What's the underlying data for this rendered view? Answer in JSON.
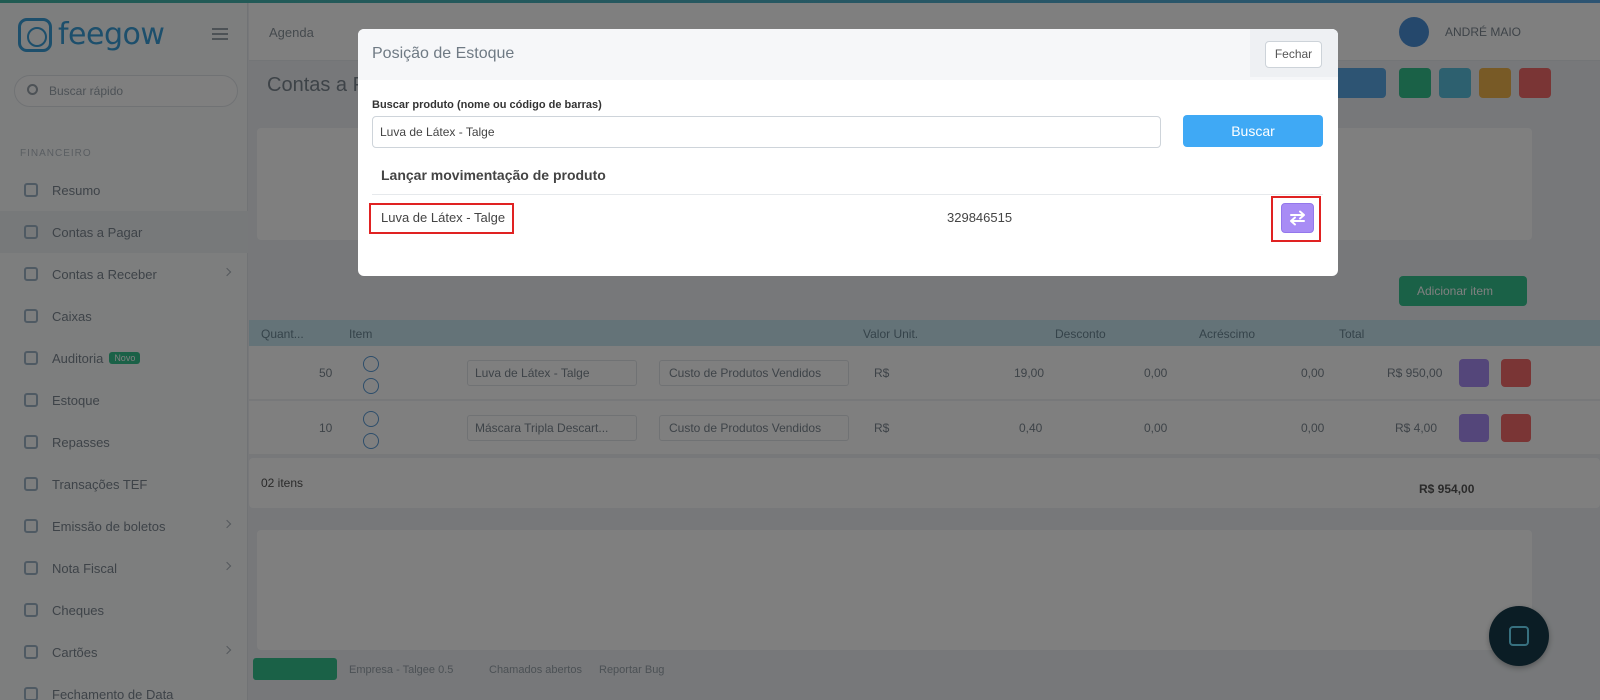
{
  "background": {
    "logo_text": "feegow",
    "side_search_placeholder": "Buscar rápido",
    "side_group": "FINANCEIRO",
    "sidebar_items": [
      {
        "label": "Resumo",
        "badge": ""
      },
      {
        "label": "Contas a Pagar",
        "badge": ""
      },
      {
        "label": "Contas a Receber",
        "badge": ""
      },
      {
        "label": "Caixas",
        "badge": ""
      },
      {
        "label": "Auditoria",
        "badge": "Novo"
      },
      {
        "label": "Estoque",
        "badge": ""
      },
      {
        "label": "Repasses",
        "badge": ""
      },
      {
        "label": "Transações TEF",
        "badge": ""
      },
      {
        "label": "Emissão de boletos",
        "badge": ""
      },
      {
        "label": "Nota Fiscal",
        "badge": ""
      },
      {
        "label": "Cheques",
        "badge": ""
      },
      {
        "label": "Cartões",
        "badge": ""
      },
      {
        "label": "Fechamento de Data",
        "badge": ""
      }
    ],
    "top_menu": "Agenda",
    "user_name": "ANDRÉ MAIO",
    "page_title": "Contas a P",
    "add_button": "Adicionar item",
    "items_count": "02 itens",
    "table_headers": [
      "Quant...",
      "Item",
      "Valor Unit.",
      "Desconto",
      "Acréscimo",
      "Total"
    ],
    "rows": [
      {
        "qty": "50",
        "item": "Luva de Látex - Talge",
        "category": "Custo de Produtos Vendidos",
        "unit": "R$",
        "value": "19,00",
        "discount": "0,00",
        "extra": "0,00",
        "total": "R$ 950,00"
      },
      {
        "qty": "10",
        "item": "Máscara Tripla Descart...",
        "category": "Custo de Produtos Vendidos",
        "unit": "R$",
        "value": "0,40",
        "discount": "0,00",
        "extra": "0,00",
        "total": "R$ 4,00"
      }
    ],
    "summary": "R$ 954,00",
    "footer": [
      "Empresa - Talgee 0.5",
      "Chamados abertos",
      "Reportar Bug"
    ]
  },
  "modal": {
    "title": "Posição de Estoque",
    "close_label": "Fechar",
    "search_label": "Buscar produto (nome ou código de barras)",
    "search_value": "Luva de Látex - Talge",
    "search_button": "Buscar",
    "section_title": "Lançar movimentação de produto",
    "results": [
      {
        "name": "Luva de Látex - Talge",
        "code": "329846515",
        "action_icon": "swap-arrows-icon"
      }
    ],
    "highlight_color": "#e02222",
    "action_color": "#a88cf5",
    "primary_color": "#3fa9f5"
  }
}
